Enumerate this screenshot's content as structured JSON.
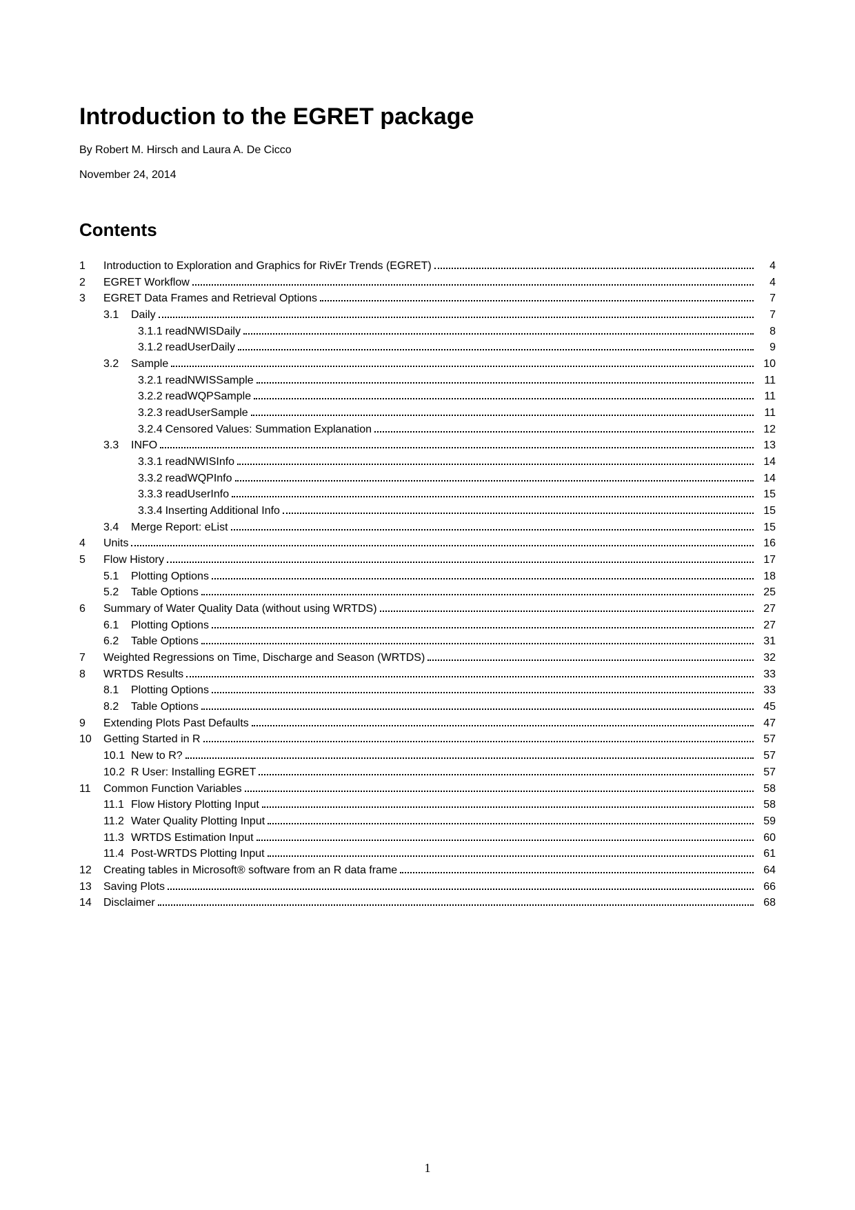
{
  "title": "Introduction to the EGRET package",
  "byline": "By Robert M. Hirsch and Laura A. De Cicco",
  "date": "November 24, 2014",
  "contents_heading": "Contents",
  "toc": [
    {
      "level": 0,
      "chap": "1",
      "label": "Introduction to Exploration and Graphics for RivEr Trends (EGRET)",
      "page": "4"
    },
    {
      "level": 0,
      "chap": "2",
      "label": "EGRET Workflow",
      "page": "4"
    },
    {
      "level": 0,
      "chap": "3",
      "label": "EGRET Data Frames and Retrieval Options",
      "page": "7"
    },
    {
      "level": 1,
      "sec": "3.1",
      "label": "Daily",
      "page": "7"
    },
    {
      "level": 2,
      "subsub": "3.1.1",
      "label": "readNWISDaily",
      "page": "8"
    },
    {
      "level": 2,
      "subsub": "3.1.2",
      "label": "readUserDaily",
      "page": "9"
    },
    {
      "level": 1,
      "sec": "3.2",
      "label": "Sample",
      "page": "10"
    },
    {
      "level": 2,
      "subsub": "3.2.1",
      "label": "readNWISSample",
      "page": "11"
    },
    {
      "level": 2,
      "subsub": "3.2.2",
      "label": "readWQPSample",
      "page": "11"
    },
    {
      "level": 2,
      "subsub": "3.2.3",
      "label": "readUserSample",
      "page": "11"
    },
    {
      "level": 2,
      "subsub": "3.2.4",
      "label": "Censored Values: Summation Explanation",
      "page": "12"
    },
    {
      "level": 1,
      "sec": "3.3",
      "label": "INFO",
      "page": "13"
    },
    {
      "level": 2,
      "subsub": "3.3.1",
      "label": "readNWISInfo",
      "page": "14"
    },
    {
      "level": 2,
      "subsub": "3.3.2",
      "label": "readWQPInfo",
      "page": "14"
    },
    {
      "level": 2,
      "subsub": "3.3.3",
      "label": "readUserInfo",
      "page": "15"
    },
    {
      "level": 2,
      "subsub": "3.3.4",
      "label": "Inserting Additional Info",
      "page": "15"
    },
    {
      "level": 1,
      "sec": "3.4",
      "label": "Merge Report: eList",
      "page": "15"
    },
    {
      "level": 0,
      "chap": "4",
      "label": "Units",
      "page": "16"
    },
    {
      "level": 0,
      "chap": "5",
      "label": "Flow History",
      "page": "17"
    },
    {
      "level": 1,
      "sec": "5.1",
      "label": "Plotting Options",
      "page": "18"
    },
    {
      "level": 1,
      "sec": "5.2",
      "label": "Table Options",
      "page": "25"
    },
    {
      "level": 0,
      "chap": "6",
      "label": "Summary of Water Quality Data (without using WRTDS)",
      "page": "27"
    },
    {
      "level": 1,
      "sec": "6.1",
      "label": "Plotting Options",
      "page": "27"
    },
    {
      "level": 1,
      "sec": "6.2",
      "label": "Table Options",
      "page": "31"
    },
    {
      "level": 0,
      "chap": "7",
      "label": "Weighted Regressions on Time, Discharge and Season (WRTDS)",
      "page": "32"
    },
    {
      "level": 0,
      "chap": "8",
      "label": "WRTDS Results",
      "page": "33"
    },
    {
      "level": 1,
      "sec": "8.1",
      "label": "Plotting Options",
      "page": "33"
    },
    {
      "level": 1,
      "sec": "8.2",
      "label": "Table Options",
      "page": "45"
    },
    {
      "level": 0,
      "chap": "9",
      "label": "Extending Plots Past Defaults",
      "page": "47"
    },
    {
      "level": 0,
      "chap": "10",
      "label": "Getting Started in R",
      "page": "57"
    },
    {
      "level": 1,
      "sec": "10.1",
      "label": "New to R?",
      "page": "57"
    },
    {
      "level": 1,
      "sec": "10.2",
      "label": "R User: Installing EGRET",
      "page": "57"
    },
    {
      "level": 0,
      "chap": "11",
      "label": "Common Function Variables",
      "page": "58"
    },
    {
      "level": 1,
      "sec": "11.1",
      "label": "Flow History Plotting Input",
      "page": "58"
    },
    {
      "level": 1,
      "sec": "11.2",
      "label": "Water Quality Plotting Input",
      "page": "59"
    },
    {
      "level": 1,
      "sec": "11.3",
      "label": "WRTDS Estimation Input",
      "page": "60"
    },
    {
      "level": 1,
      "sec": "11.4",
      "label": "Post-WRTDS Plotting Input",
      "page": "61"
    },
    {
      "level": 0,
      "chap": "12",
      "label": "Creating tables in Microsoft® software from an R data frame",
      "page": "64"
    },
    {
      "level": 0,
      "chap": "13",
      "label": "Saving Plots",
      "page": "66"
    },
    {
      "level": 0,
      "chap": "14",
      "label": "Disclaimer",
      "page": "68"
    }
  ],
  "page_number": "1"
}
